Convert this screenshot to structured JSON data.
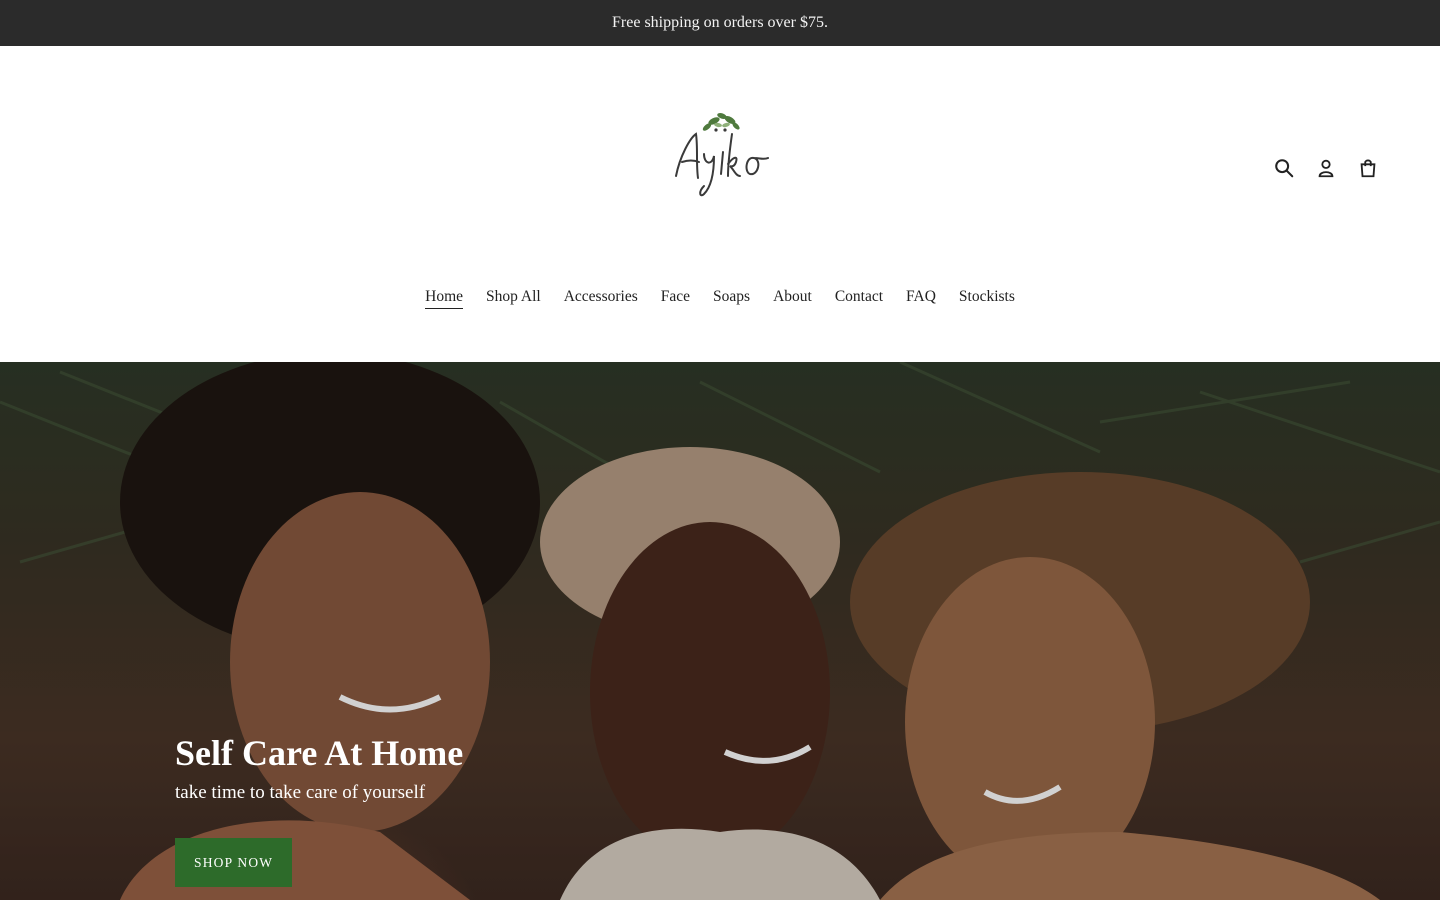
{
  "announcement": {
    "text": "Free shipping on orders over $75."
  },
  "brand": {
    "logo_text": "Ayïko",
    "logo_color": "#3a3a3a",
    "leaf_color": "#4f7a3e"
  },
  "header_icons": [
    {
      "name": "search-icon"
    },
    {
      "name": "account-icon"
    },
    {
      "name": "cart-icon"
    }
  ],
  "nav": {
    "items": [
      {
        "label": "Home",
        "active": true
      },
      {
        "label": "Shop All"
      },
      {
        "label": "Accessories"
      },
      {
        "label": "Face"
      },
      {
        "label": "Soaps"
      },
      {
        "label": "About"
      },
      {
        "label": "Contact"
      },
      {
        "label": "FAQ"
      },
      {
        "label": "Stockists"
      }
    ]
  },
  "hero": {
    "title": "Self Care At Home",
    "subtitle": "take time to take care of yourself",
    "button_label": "SHOP NOW",
    "button_color": "#2d6b2a"
  }
}
